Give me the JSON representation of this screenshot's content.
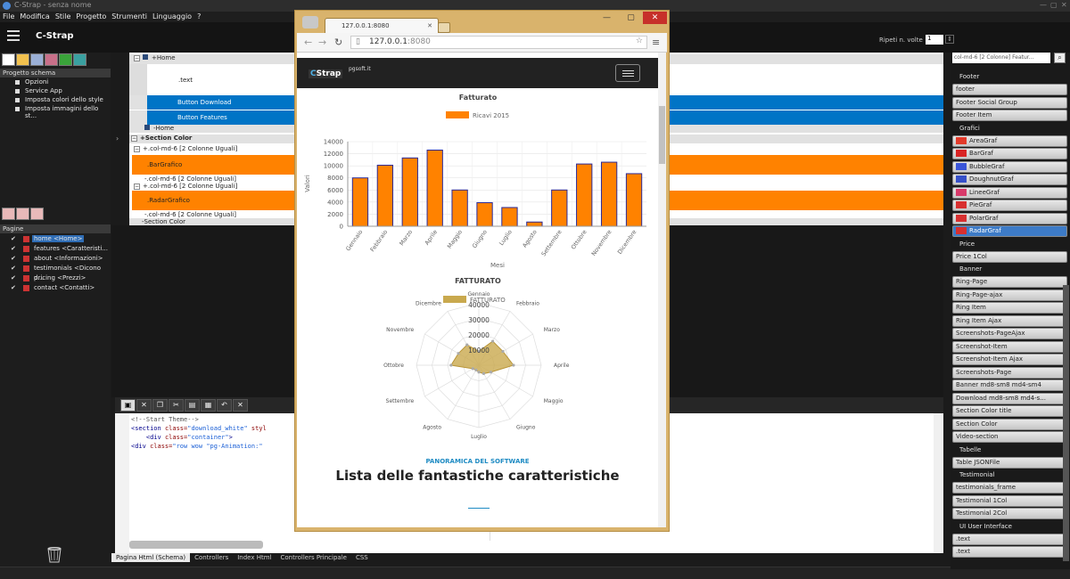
{
  "window": {
    "title": "C-Strap - senza nome"
  },
  "menu": [
    "File",
    "Modifica",
    "Stile",
    "Progetto",
    "Strumenti",
    "Linguaggio",
    "?"
  ],
  "app": {
    "title": "C-Strap",
    "repeat_label": "Ripeti n. volte",
    "repeat_value": "1"
  },
  "left": {
    "schema_header": "Progetto schema",
    "schema_items": [
      "Opzioni",
      "Service App",
      "Imposta colori dello style",
      "Imposta immagini dello st..."
    ],
    "pages_header": "Pagine",
    "pages": [
      {
        "label": "home <Home>",
        "selected": true
      },
      {
        "label": "features <Caratteristi...",
        "selected": false
      },
      {
        "label": "about <Informazioni>",
        "selected": false
      },
      {
        "label": "testimonials <Dicono d...",
        "selected": false
      },
      {
        "label": "pricing <Prezzi>",
        "selected": false
      },
      {
        "label": "contact <Contatti>",
        "selected": false
      }
    ]
  },
  "schema": {
    "r0": "+Home",
    "r1": ".text",
    "r2": "Button Download",
    "r3": "Button Features",
    "r4": "-Home",
    "r5": "+Section Color",
    "r6": "+.col-md-6 [2 Colonne Uguali]",
    "r7": ".BarGrafico",
    "r8": "-.col-md-6 [2 Colonne Uguali]",
    "r9": "+.col-md-6 [2 Colonne Uguali]",
    "r10": ".RadarGrafico",
    "r11": "-.col-md-6 [2 Colonne Uguali]",
    "r12": "-Section Color"
  },
  "editor": {
    "line1": "<!--Start Theme-->",
    "line2a": "<section ",
    "line2b": "class=",
    "line2c": "\"download_white\"",
    "line2d": " styl",
    "line3a": "<div ",
    "line3b": "class=",
    "line3c": "\"container\"",
    "line3d": ">",
    "line4a": "<div ",
    "line4b": "class=",
    "line4c": "\"row wow ",
    "line4d": "\"pg-Animation:\""
  },
  "bottom_tabs": [
    "Pagina Html (Schema)",
    "Controllers",
    "Index Html",
    "Controllers Principale",
    "CSS"
  ],
  "right": {
    "search_placeholder": "col-md-6 [2 Colonne] Featur...",
    "groups": [
      {
        "name": "Footer",
        "items": [
          {
            "label": "footer"
          },
          {
            "label": "Footer Social Group"
          },
          {
            "label": "Footer Item"
          }
        ]
      },
      {
        "name": "Grafici",
        "items": [
          {
            "label": "AreaGraf",
            "icon": "area-chart-icon",
            "color": "#e23a2a"
          },
          {
            "label": "BarGraf",
            "icon": "bar-chart-icon",
            "color": "#d92424"
          },
          {
            "label": "BubbleGraf",
            "icon": "bubble-chart-icon",
            "color": "#3a55d8"
          },
          {
            "label": "DoughnutGraf",
            "icon": "doughnut-chart-icon",
            "color": "#3650c8"
          },
          {
            "label": "LineeGraf",
            "icon": "line-chart-icon",
            "color": "#d83a6a"
          },
          {
            "label": "PieGraf",
            "icon": "pie-chart-icon",
            "color": "#d83030"
          },
          {
            "label": "PolarGraf",
            "icon": "polar-chart-icon",
            "color": "#d83030"
          },
          {
            "label": "RadarGraf",
            "icon": "radar-chart-icon",
            "color": "#d83030",
            "selected": true
          }
        ]
      },
      {
        "name": "Price",
        "items": [
          {
            "label": "Price 1Col"
          }
        ]
      },
      {
        "name": "Banner",
        "items": [
          {
            "label": "Ring-Page"
          },
          {
            "label": "Ring-Page-ajax"
          },
          {
            "label": "Ring Item"
          },
          {
            "label": "Ring Item Ajax"
          },
          {
            "label": "Screenshots-PageAjax"
          },
          {
            "label": "Screenshot-Item"
          },
          {
            "label": "Screenshot-Item Ajax"
          },
          {
            "label": "Screenshots-Page"
          },
          {
            "label": "Banner md8-sm8  md4-sm4"
          },
          {
            "label": "Download md8-sm8  md4-s..."
          },
          {
            "label": "Section Color title"
          },
          {
            "label": "Section Color"
          },
          {
            "label": "Video-section"
          }
        ]
      },
      {
        "name": "Tabelle",
        "items": [
          {
            "label": "Table JSONFile"
          }
        ]
      },
      {
        "name": "Testimonial",
        "items": [
          {
            "label": "testimonials_frame"
          },
          {
            "label": "Testimonial 1Col"
          },
          {
            "label": "Testimonial 2Col"
          }
        ]
      },
      {
        "name": "UI User Interface",
        "items": [
          {
            "label": ".text"
          },
          {
            "label": ".text"
          }
        ]
      }
    ]
  },
  "browser": {
    "tab_title": "127.0.0.1:8080",
    "url_host": "127.0.0.1",
    "url_port": ":8080",
    "site_sub": "pgsoft.it",
    "kicker": "PANORAMICA DEL SOFTWARE",
    "heading": "Lista delle fantastiche caratteristiche"
  },
  "chart_data": [
    {
      "type": "bar",
      "title": "Fatturato",
      "xlabel": "Mesi",
      "ylabel": "Valori",
      "legend": "top",
      "grid": true,
      "ylim": [
        0,
        14000
      ],
      "categories": [
        "Gennaio",
        "Febbraio",
        "Marzo",
        "Aprile",
        "Maggio",
        "Giugno",
        "Luglio",
        "Agosto",
        "Settembre",
        "Ottobre",
        "Novembre",
        "Dicembre"
      ],
      "series": [
        {
          "name": "Ricavi 2015",
          "color": "#ff8200",
          "values": [
            8000,
            10100,
            11300,
            12600,
            6000,
            3900,
            3100,
            700,
            6000,
            10300,
            10600,
            8700
          ]
        }
      ],
      "yticks": [
        0,
        2000,
        4000,
        6000,
        8000,
        10000,
        12000,
        14000
      ]
    },
    {
      "type": "radar",
      "title": "FATTURATO",
      "legend": "top",
      "categories": [
        "Gennaio",
        "Febbraio",
        "Marzo",
        "Aprile",
        "Maggio",
        "Giugno",
        "Luglio",
        "Agosto",
        "Settembre",
        "Ottobre",
        "Novembre",
        "Dicembre"
      ],
      "series": [
        {
          "name": "FATTURATO",
          "color": "#c9a94e",
          "values": [
            10000,
            20000,
            20000,
            25000,
            10000,
            7000,
            5000,
            4000,
            5000,
            20000,
            17000,
            17000
          ]
        }
      ],
      "ticks": [
        "10000",
        "20000",
        "30000",
        "40000"
      ],
      "rmax": 45000
    }
  ]
}
